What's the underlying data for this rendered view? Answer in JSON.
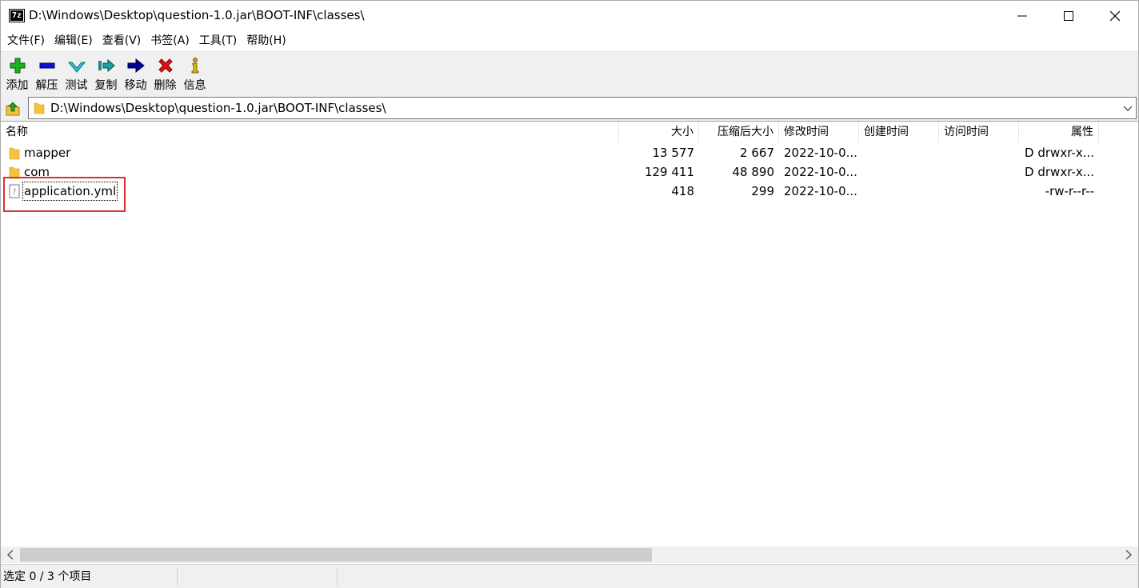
{
  "window": {
    "title": "D:\\Windows\\Desktop\\question-1.0.jar\\BOOT-INF\\classes\\",
    "app_icon_text": "7z"
  },
  "menu": [
    {
      "label": "文件(F)"
    },
    {
      "label": "编辑(E)"
    },
    {
      "label": "查看(V)"
    },
    {
      "label": "书签(A)"
    },
    {
      "label": "工具(T)"
    },
    {
      "label": "帮助(H)"
    }
  ],
  "toolbar": [
    {
      "label": "添加",
      "icon": "plus-icon",
      "color": "#1ea61e"
    },
    {
      "label": "解压",
      "icon": "minus-icon",
      "color": "#0000c8"
    },
    {
      "label": "测试",
      "icon": "check-icon",
      "color": "#20b8c8"
    },
    {
      "label": "复制",
      "icon": "copy-arrow-icon",
      "color": "#1a8a8a"
    },
    {
      "label": "移动",
      "icon": "move-arrow-icon",
      "color": "#000090"
    },
    {
      "label": "删除",
      "icon": "delete-x-icon",
      "color": "#e00000"
    },
    {
      "label": "信息",
      "icon": "info-icon",
      "color": "#c8a000"
    }
  ],
  "address": {
    "path": "D:\\Windows\\Desktop\\question-1.0.jar\\BOOT-INF\\classes\\"
  },
  "columns": [
    {
      "label": "名称"
    },
    {
      "label": "大小"
    },
    {
      "label": "压缩后大小"
    },
    {
      "label": "修改时间"
    },
    {
      "label": "创建时间"
    },
    {
      "label": "访问时间"
    },
    {
      "label": "属性"
    }
  ],
  "files": [
    {
      "name": "mapper",
      "type": "folder",
      "size": "13 577",
      "packed": "2 667",
      "modified": "2022-10-0...",
      "created": "",
      "accessed": "",
      "attributes": "D drwxr-x..."
    },
    {
      "name": "com",
      "type": "folder",
      "size": "129 411",
      "packed": "48 890",
      "modified": "2022-10-0...",
      "created": "",
      "accessed": "",
      "attributes": "D drwxr-x..."
    },
    {
      "name": "application.yml",
      "type": "file",
      "size": "418",
      "packed": "299",
      "modified": "2022-10-0...",
      "created": "",
      "accessed": "",
      "attributes": "-rw-r--r--"
    }
  ],
  "status": {
    "selection": "选定 0 / 3 个项目",
    "seg2": "",
    "seg3": ""
  },
  "colors": {
    "highlight_border": "#d9302c",
    "folder_yellow": "#f5c33b"
  }
}
